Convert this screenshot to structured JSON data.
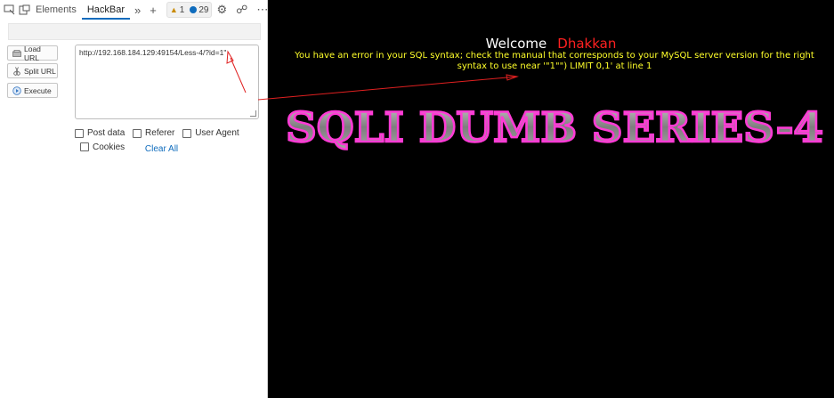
{
  "devtools": {
    "tabs": {
      "elements": "Elements",
      "hackbar": "HackBar"
    },
    "badges": {
      "warnings": "1",
      "issues": "29"
    }
  },
  "hackbar": {
    "load_url": "Load URL",
    "split_url": "Split URL",
    "execute": "Execute",
    "url_value": "http://192.168.184.129:49154/Less-4/?id=1\"",
    "options": {
      "post_data": "Post data",
      "referer": "Referer",
      "user_agent": "User Agent",
      "cookies": "Cookies",
      "clear_all": "Clear All"
    }
  },
  "page": {
    "welcome": "Welcome",
    "user": "Dhakkan",
    "error": "You have an error in your SQL syntax; check the manual that corresponds to your MySQL server version for the right syntax to use near '\"1\"\") LIMIT 0,1' at line 1",
    "banner": "SQLI DUMB SERIES-4"
  },
  "colors": {
    "accent": "#0f6cbd",
    "user_name": "#ff2020",
    "error_text": "#ffff2a",
    "arrow": "#e02020",
    "banner_fill": "#8e8e8e",
    "banner_glow": "#ff3bd6"
  },
  "icons": [
    "inspect-icon",
    "device-icon",
    "chevron-double-right-icon",
    "plus-icon",
    "warning-icon",
    "issue-dot-icon",
    "gear-icon",
    "connection-icon",
    "more-icon",
    "close-icon",
    "load-url-icon",
    "split-url-icon",
    "execute-icon"
  ]
}
